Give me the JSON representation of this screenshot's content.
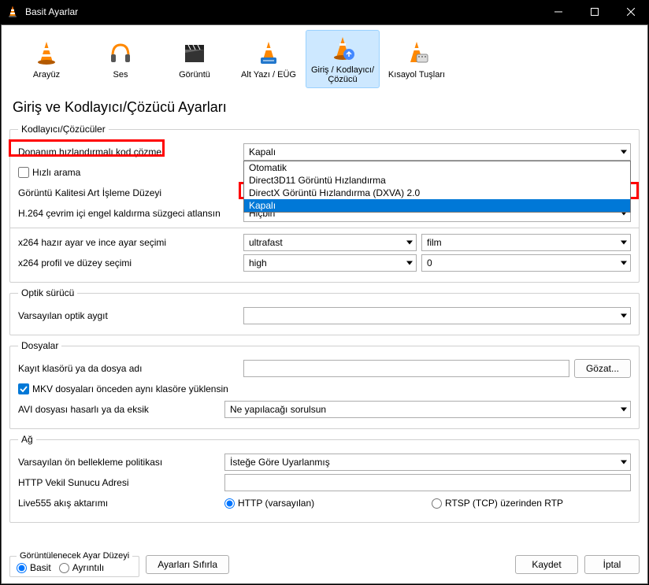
{
  "window": {
    "title": "Basit Ayarlar"
  },
  "tabs": [
    {
      "label": "Arayüz"
    },
    {
      "label": "Ses"
    },
    {
      "label": "Görüntü"
    },
    {
      "label": "Alt Yazı / EÜG"
    },
    {
      "label": "Giriş / Kodlayıcı/Çözücü"
    },
    {
      "label": "Kısayol Tuşları"
    }
  ],
  "heading": "Giriş ve Kodlayıcı/Çözücü Ayarları",
  "codecs": {
    "legend": "Kodlayıcı/Çözücüler",
    "hw_label": "Donanım hızlandırmalı kod çözme",
    "hw_value": "Kapalı",
    "hw_options": [
      "Otomatik",
      "Direct3D11 Görüntü Hızlandırma",
      "DirectX Görüntü Hızlandırma (DXVA) 2.0",
      "Kapalı"
    ],
    "fast_seek_label": "Hızlı arama",
    "quality_label": "Görüntü Kalitesi Art İşleme Düzeyi",
    "quality_value": "",
    "deblock_label": "H.264 çevrim içi engel kaldırma süzgeci atlansın",
    "deblock_value": "Hiçbiri",
    "x264_preset_label": "x264 hazır ayar ve ince ayar seçimi",
    "x264_preset_value": "ultrafast",
    "x264_tune_value": "film",
    "x264_profile_label": "x264 profil ve düzey seçimi",
    "x264_profile_value": "high",
    "x264_level_value": "0"
  },
  "optical": {
    "legend": "Optik sürücü",
    "device_label": "Varsayılan optik aygıt",
    "device_value": ""
  },
  "files": {
    "legend": "Dosyalar",
    "record_label": "Kayıt klasörü ya da dosya adı",
    "record_value": "",
    "browse_label": "Gözat...",
    "mkv_label": "MKV dosyaları önceden aynı klasöre yüklensin",
    "avi_label": "AVI dosyası hasarlı ya da eksik",
    "avi_value": "Ne yapılacağı sorulsun"
  },
  "network": {
    "legend": "Ağ",
    "cache_label": "Varsayılan ön bellekleme politikası",
    "cache_value": "İsteğe Göre Uyarlanmış",
    "proxy_label": "HTTP Vekil Sunucu Adresi",
    "proxy_value": "",
    "live555_label": "Live555 akış aktarımı",
    "http_label": "HTTP (varsayılan)",
    "rtsp_label": "RTSP (TCP) üzerinden RTP"
  },
  "footer": {
    "show_label": "Görüntülenecek Ayar Düzeyi",
    "simple_label": "Basit",
    "detailed_label": "Ayrıntılı",
    "reset_label": "Ayarları Sıfırla",
    "save_label": "Kaydet",
    "cancel_label": "İptal"
  }
}
